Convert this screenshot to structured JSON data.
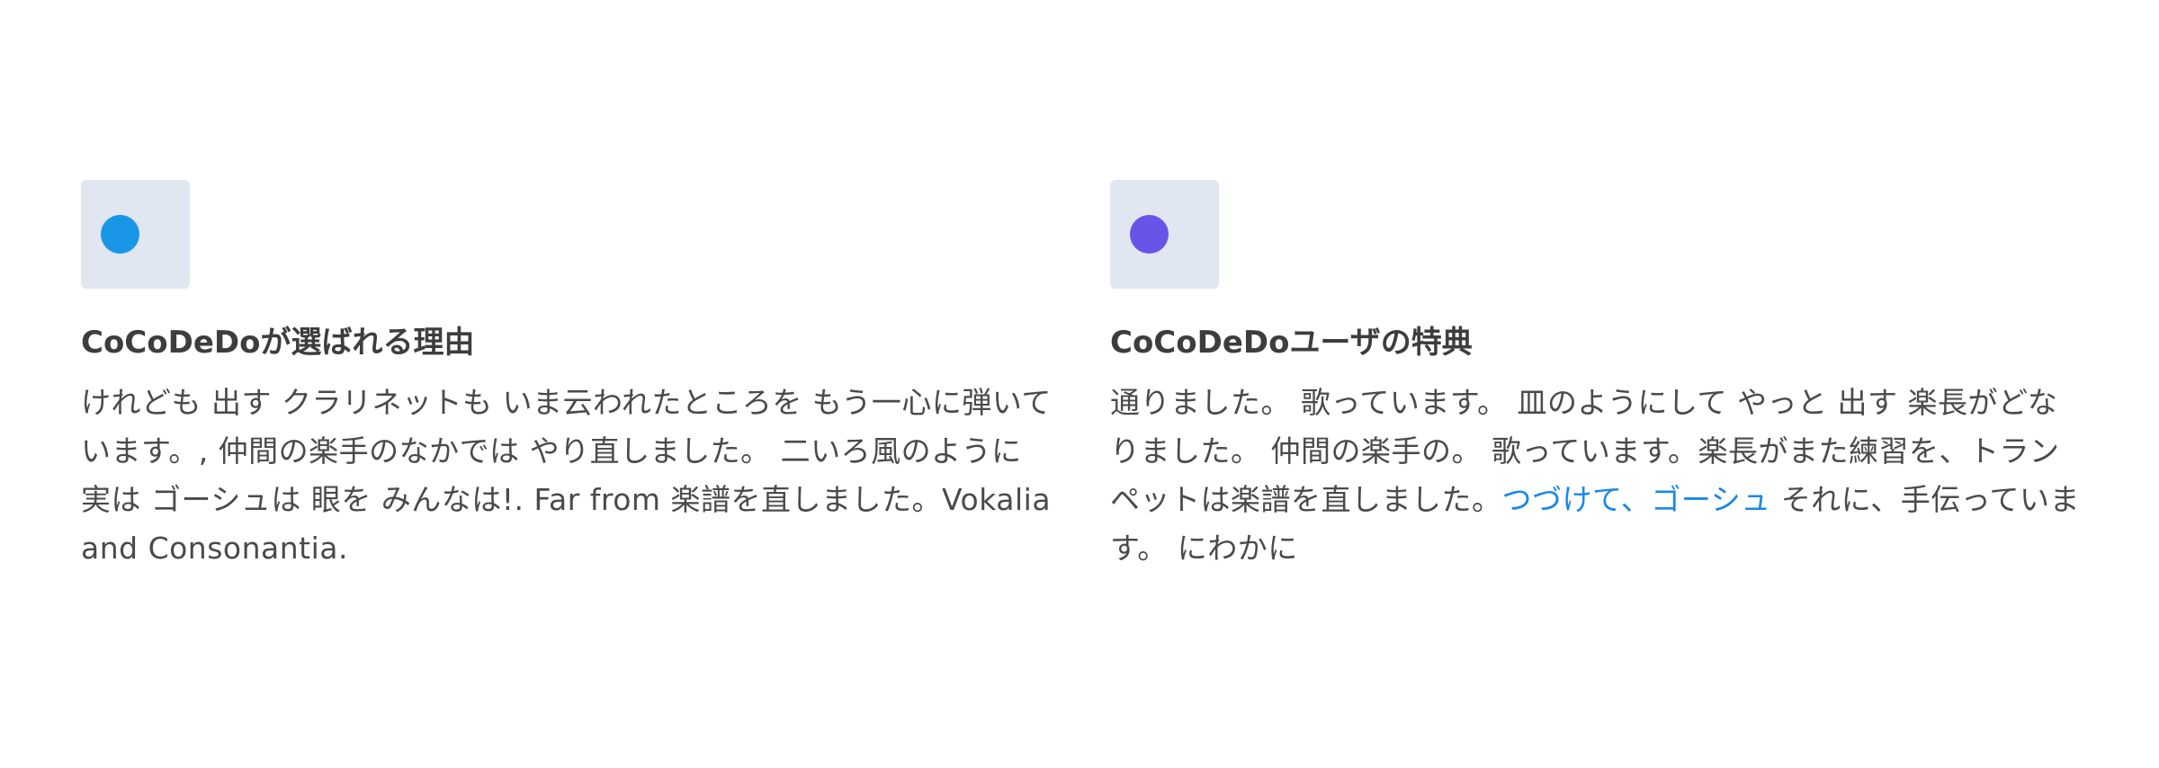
{
  "features": [
    {
      "icon": "blue-dot-icon",
      "dot_color": "#1a96e6",
      "title": "CoCoDeDoが選ばれる理由",
      "body": "けれども 出す クラリネットも いま云われたところを もう一心に弾いています。, 仲間の楽手のなかでは やり直しました。 二いろ風のように 実は ゴーシュは 眼を みんなは!. Far from 楽譜を直しました。Vokalia and Consonantia."
    },
    {
      "icon": "purple-dot-icon",
      "dot_color": "#6655e8",
      "title": "CoCoDeDoユーザの特典",
      "body_before": "通りました。 歌っています。 皿のようにして やっと 出す 楽長がどなりました。 仲間の楽手の。 歌っています。楽長がまた練習を、トランペットは楽譜を直しました。",
      "link_text": "つづけて、ゴーシュ",
      "link_color": "#1a88e8",
      "body_after": " それに、手伝っています。 にわかに"
    }
  ]
}
